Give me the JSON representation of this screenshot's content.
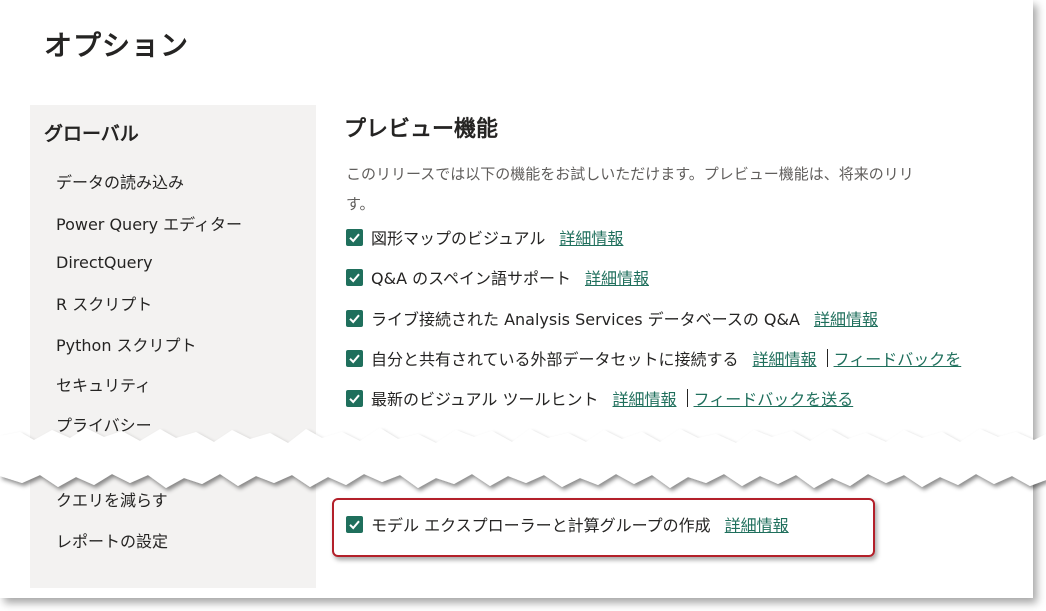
{
  "dialog": {
    "title": "オプション"
  },
  "sidebar": {
    "header": "グローバル",
    "items": [
      {
        "label": "データの読み込み"
      },
      {
        "label": "Power Query エディター"
      },
      {
        "label": "DirectQuery"
      },
      {
        "label": "R スクリプト"
      },
      {
        "label": "Python スクリプト"
      },
      {
        "label": "セキュリティ"
      },
      {
        "label": "プライバシー"
      },
      {
        "label": "クエリを減らす"
      },
      {
        "label": "レポートの設定"
      }
    ]
  },
  "main": {
    "title": "プレビュー機能",
    "description_line1": "このリリースでは以下の機能をお試しいただけます。プレビュー機能は、将来のリリ",
    "description_line2": "す。",
    "features": [
      {
        "label": "図形マップのビジュアル",
        "checked": true,
        "link": "詳細情報"
      },
      {
        "label": "Q&A のスペイン語サポート",
        "checked": true,
        "link": "詳細情報"
      },
      {
        "label": "ライブ接続された Analysis Services データベースの Q&A",
        "checked": true,
        "link": "詳細情報"
      },
      {
        "label": "自分と共有されている外部データセットに接続する",
        "checked": true,
        "link": "詳細情報",
        "feedback": "フィードバックを"
      },
      {
        "label": "最新のビジュアル ツールヒント",
        "checked": true,
        "link": "詳細情報",
        "feedback": "フィードバックを送る"
      },
      {
        "label": "モデル エクスプローラーと計算グループの作成",
        "checked": true,
        "link": "詳細情報"
      }
    ]
  },
  "colors": {
    "accent": "#1f6f5c",
    "highlight": "#b3202a",
    "sidebar_bg": "#f3f2f1"
  }
}
